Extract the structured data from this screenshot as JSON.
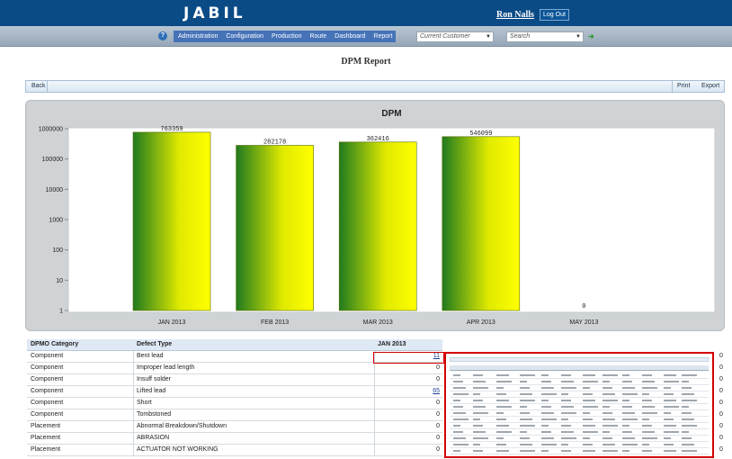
{
  "header": {
    "logo": "JABIL",
    "user_name": "Ron Nalls",
    "logout_label": "Log Out",
    "help_icon": "help-icon"
  },
  "nav": {
    "menu": [
      "Administration",
      "Configuration",
      "Production",
      "Route",
      "Dashboard",
      "Report"
    ],
    "customer_select": "Current Customer",
    "search_select": "Search",
    "go_icon": "arrow-right-icon"
  },
  "page": {
    "title": "DPM Report"
  },
  "toolbar": {
    "back_label": "Back",
    "print_label": "Print",
    "export_label": "Export"
  },
  "chart_data": {
    "type": "bar",
    "title": "DPM",
    "scale": "log",
    "categories": [
      "JAN 2013",
      "FEB 2013",
      "MAR 2013",
      "APR 2013",
      "MAY 2013"
    ],
    "values": [
      763359,
      282178,
      362416,
      546099,
      0
    ],
    "value_labels": [
      "763359",
      "282178",
      "362416",
      "546099",
      "0"
    ],
    "ylim": [
      1,
      1000000
    ],
    "y_ticks": [
      1,
      10,
      100,
      1000,
      10000,
      100000,
      1000000
    ],
    "y_tick_labels": [
      "1",
      "10",
      "100",
      "1000",
      "10000",
      "100000",
      "1000000"
    ],
    "grid": false,
    "bar_gradient": [
      "#1f7a1f",
      "#ffff00"
    ]
  },
  "table": {
    "headers": [
      "DPMO Category",
      "Defect Type",
      "JAN 2013"
    ],
    "rows": [
      {
        "category": "Component",
        "defect": "Bent lead",
        "value": "11",
        "link": true
      },
      {
        "category": "Component",
        "defect": "Improper lead length",
        "value": "0",
        "link": false
      },
      {
        "category": "Component",
        "defect": "Insuff solder",
        "value": "0",
        "link": false
      },
      {
        "category": "Component",
        "defect": "Lifted lead",
        "value": "65",
        "link": true
      },
      {
        "category": "Component",
        "defect": "Short",
        "value": "0",
        "link": false
      },
      {
        "category": "Component",
        "defect": "Tombstoned",
        "value": "0",
        "link": false
      },
      {
        "category": "Placement",
        "defect": "Abnormal Breakdown/Shutdown",
        "value": "0",
        "link": false
      },
      {
        "category": "Placement",
        "defect": "ABRASION",
        "value": "0",
        "link": false
      },
      {
        "category": "Placement",
        "defect": "ACTUATOR NOT WORKING",
        "value": "0",
        "link": false
      }
    ],
    "right_column_values": [
      "0",
      "0",
      "0",
      "0",
      "0",
      "0",
      "0",
      "0",
      "0"
    ]
  },
  "colors": {
    "header_blue": "#0a4b86",
    "menu_blue": "#4673b8",
    "highlight_red": "#d40000"
  }
}
